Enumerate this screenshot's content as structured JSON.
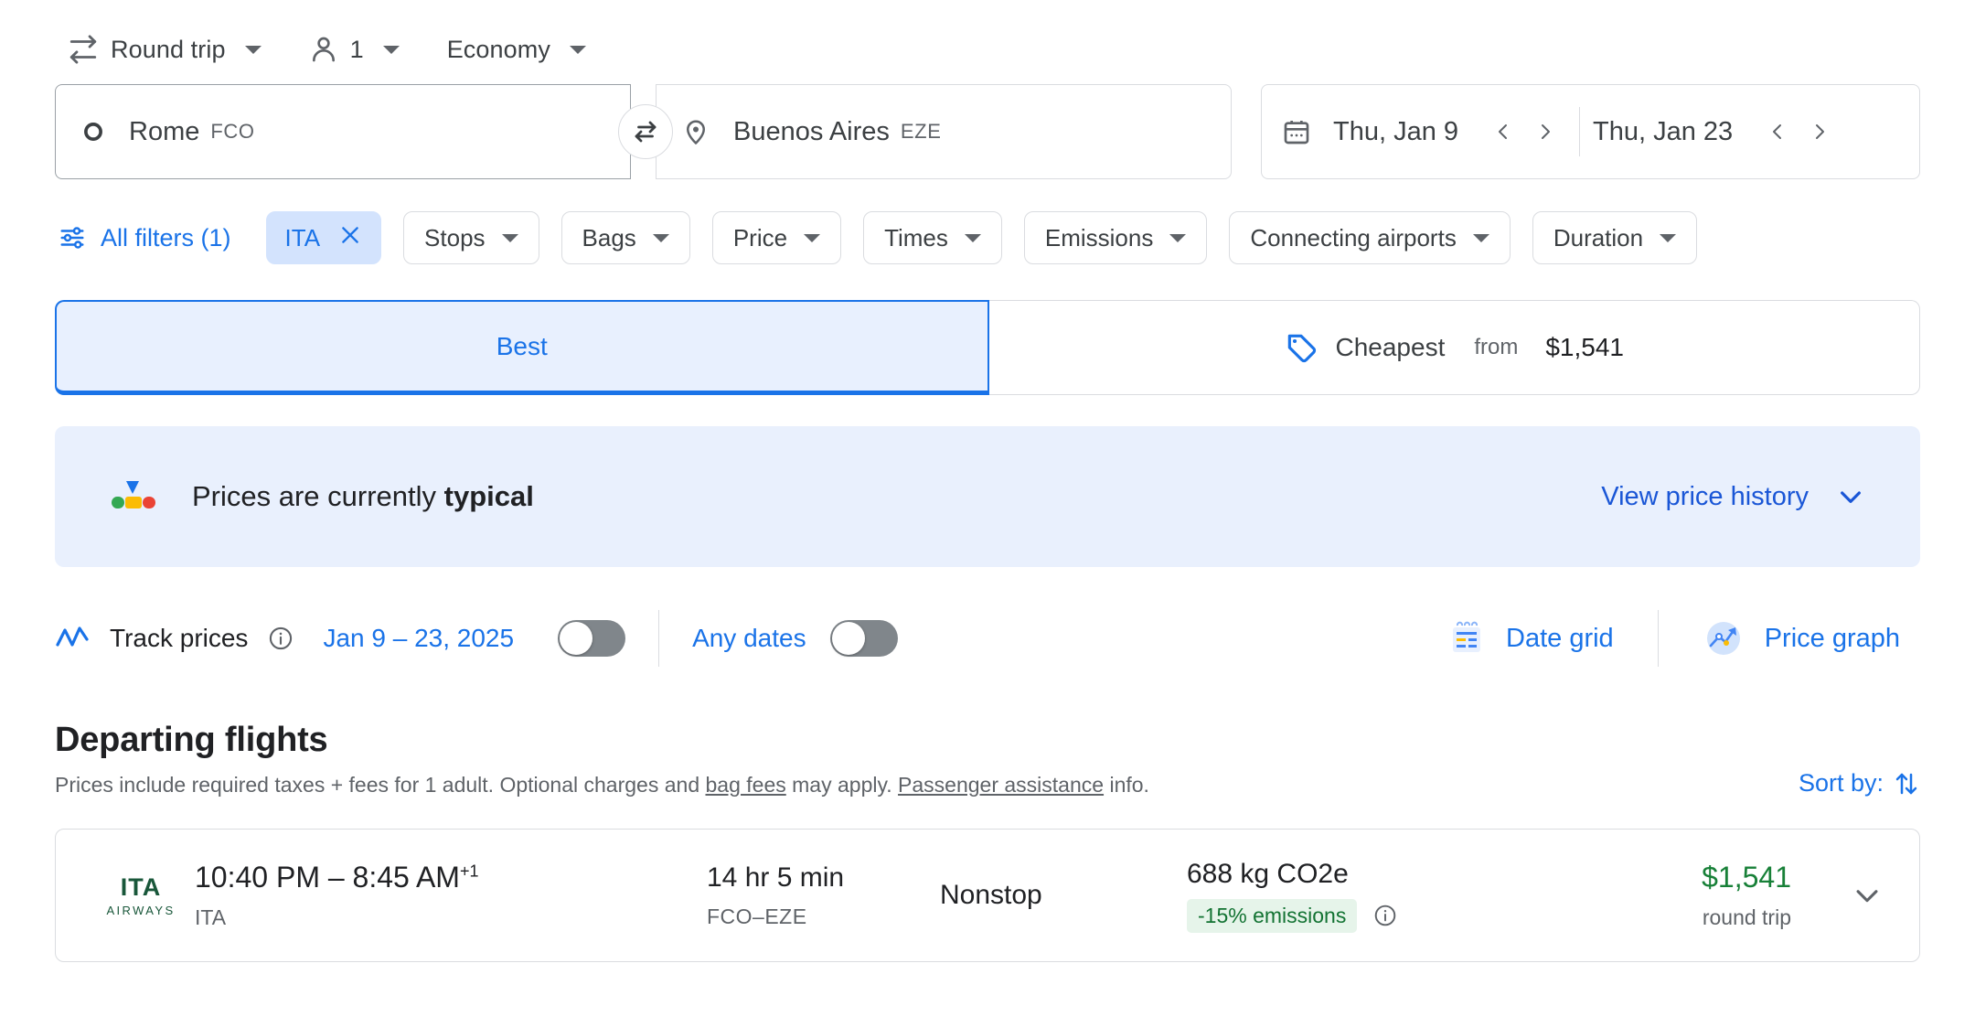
{
  "trip_options": [
    {
      "icon": "swap-horizontal-icon",
      "label": "Round trip",
      "caret": true
    },
    {
      "icon": "person-icon",
      "label": "1",
      "caret": true
    },
    {
      "icon": "",
      "label": "Economy",
      "caret": true
    }
  ],
  "search": {
    "origin": {
      "icon": "circle-outline-icon",
      "city": "Rome",
      "code": "FCO"
    },
    "destination": {
      "icon": "map-pin-icon",
      "city": "Buenos Aires",
      "code": "EZE"
    },
    "swap_icon": "swap-arrows-icon",
    "calendar_icon": "calendar-icon",
    "depart_date": "Thu, Jan 9",
    "return_date": "Thu, Jan 23",
    "prev_arrow": "chevron-left-icon",
    "next_arrow": "chevron-right-icon"
  },
  "filters": {
    "all_filters_icon": "tune-filter-icon",
    "all_filters_label": "All filters (1)",
    "active_chip": {
      "label": "ITA",
      "remove_icon": "close-icon"
    },
    "chips": [
      {
        "label": "Stops"
      },
      {
        "label": "Bags"
      },
      {
        "label": "Price"
      },
      {
        "label": "Times"
      },
      {
        "label": "Emissions"
      },
      {
        "label": "Connecting airports"
      },
      {
        "label": "Duration"
      }
    ]
  },
  "tabs": {
    "best": {
      "label": "Best",
      "selected": true
    },
    "cheapest": {
      "icon": "price-tag-icon",
      "label": "Cheapest",
      "from_label": "from",
      "price": "$1,541"
    }
  },
  "banner": {
    "icon": "price-gauge-icon",
    "text_prefix": "Prices are currently ",
    "text_emphasis": "typical",
    "link_label": "View price history",
    "link_icon": "chevron-down-icon"
  },
  "track": {
    "icon": "trending-chart-icon",
    "label": "Track prices",
    "info_icon": "info-icon",
    "dates": "Jan 9 – 23, 2025",
    "toggle_on": false,
    "any_dates_label": "Any dates",
    "any_dates_toggle_on": false,
    "date_grid": {
      "icon": "date-grid-icon",
      "label": "Date grid"
    },
    "price_graph": {
      "icon": "price-graph-icon",
      "label": "Price graph"
    }
  },
  "departing": {
    "title": "Departing flights",
    "note_part1": "Prices include required taxes + fees for 1 adult. Optional charges and ",
    "note_link1": "bag fees",
    "note_part2": " may apply. ",
    "note_link2": "Passenger assistance",
    "note_part3": " info.",
    "sort_label": "Sort by:",
    "sort_icon": "sort-arrows-icon"
  },
  "flights": [
    {
      "airline_logo_top": "ITA",
      "airline_logo_bottom": "AIRWAYS",
      "times": "10:40 PM – 8:45 AM",
      "times_superscript": "+1",
      "airline": "ITA",
      "duration": "14 hr 5 min",
      "route": "FCO–EZE",
      "stops": "Nonstop",
      "emissions": "688 kg CO2e",
      "emissions_badge": "-15% emissions",
      "emissions_info_icon": "info-icon",
      "price": "$1,541",
      "price_sub": "round trip",
      "expand_icon": "chevron-down-icon"
    }
  ],
  "colors": {
    "accent_blue": "#1a73e8",
    "chip_active_bg": "#d3e3fd",
    "banner_bg": "#e9f0fd",
    "price_green": "#188038",
    "badge_green_bg": "#e6f4ea"
  }
}
